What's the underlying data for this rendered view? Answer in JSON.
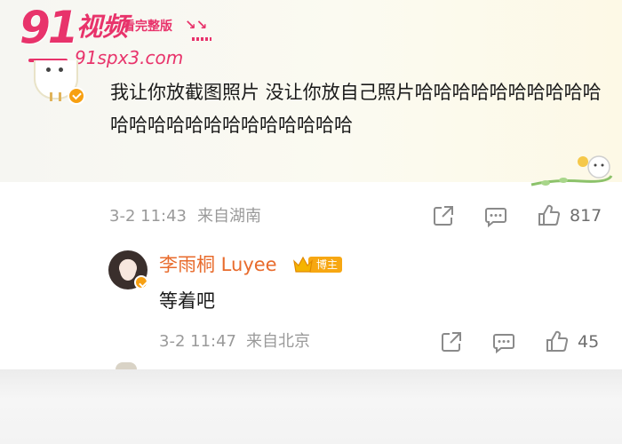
{
  "watermark": {
    "brand_number": "91",
    "brand_text": "视频",
    "tagline": "看完整版",
    "arrows": "↘↘",
    "url": "91spx3.com"
  },
  "comment": {
    "text": "我让你放截图照片 没让你放自己照片哈哈哈哈哈哈哈哈哈哈哈哈哈哈哈哈哈哈哈哈哈哈哈",
    "date": "3-2 11:43",
    "location": "来自湖南",
    "like_count": "817"
  },
  "reply": {
    "author": "李雨桐 Luyee",
    "badge": "博主",
    "text": "等着吧",
    "date": "3-2 11:47",
    "location": "来自北京",
    "like_count": "45"
  },
  "colors": {
    "watermark": "#e8336b",
    "author_name": "#e86b2c",
    "verified_badge": "#f7a012",
    "meta_text": "#9a9a9a"
  },
  "icons": [
    "share-icon",
    "comment-icon",
    "like-icon",
    "verified-icon",
    "crown-icon"
  ]
}
